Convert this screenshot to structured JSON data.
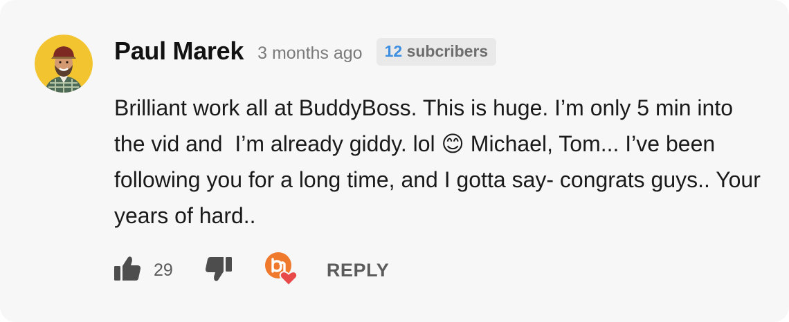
{
  "comment": {
    "author": "Paul Marek",
    "time_ago": "3 months ago",
    "subscriber_count": "12",
    "subscriber_label": "subcribers",
    "body": "Brilliant work all at BuddyBoss. This is huge. I’m only 5 min into the vid and  I’m already giddy. lol 😊 Michael, Tom... I’ve been following you for a long time, and I gotta say- congrats guys.. Your years of hard..",
    "likes": "29",
    "reply_label": "REPLY"
  },
  "icons": {
    "like": "thumbs-up-icon",
    "dislike": "thumbs-down-icon",
    "reaction": "buddyboss-heart-reaction-icon"
  },
  "colors": {
    "card_background": "#f7f7f7",
    "subscriber_count": "#3d8ee0",
    "reaction_orange": "#ef7a2e",
    "reaction_heart": "#e84a4a"
  }
}
